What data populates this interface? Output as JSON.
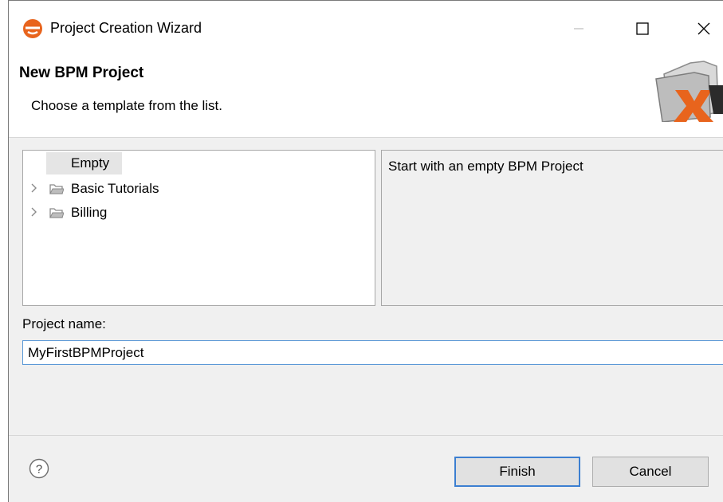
{
  "window": {
    "title": "Project Creation Wizard",
    "controls": {
      "minimize": "—",
      "maximize": "☐",
      "close": "✕"
    }
  },
  "header": {
    "title": "New BPM Project",
    "subtitle": "Choose a template from the list.",
    "image_icon": "x4-folder-icon"
  },
  "templates": {
    "items": [
      {
        "label": "Empty",
        "selected": true,
        "expandable": false,
        "folder": false
      },
      {
        "label": "Basic Tutorials",
        "selected": false,
        "expandable": true,
        "folder": true
      },
      {
        "label": "Billing",
        "selected": false,
        "expandable": true,
        "folder": true
      }
    ]
  },
  "description": {
    "text": "Start with an empty BPM Project"
  },
  "project_name": {
    "label": "Project name:",
    "value": "MyFirstBPMProject"
  },
  "footer": {
    "help_icon": "?",
    "finish_label": "Finish",
    "cancel_label": "Cancel"
  },
  "colors": {
    "accent": "#3c7fd1",
    "logo": "#e8641d",
    "dialog_bg": "#f0f0f0",
    "selection_bg": "#e5e5e5"
  }
}
